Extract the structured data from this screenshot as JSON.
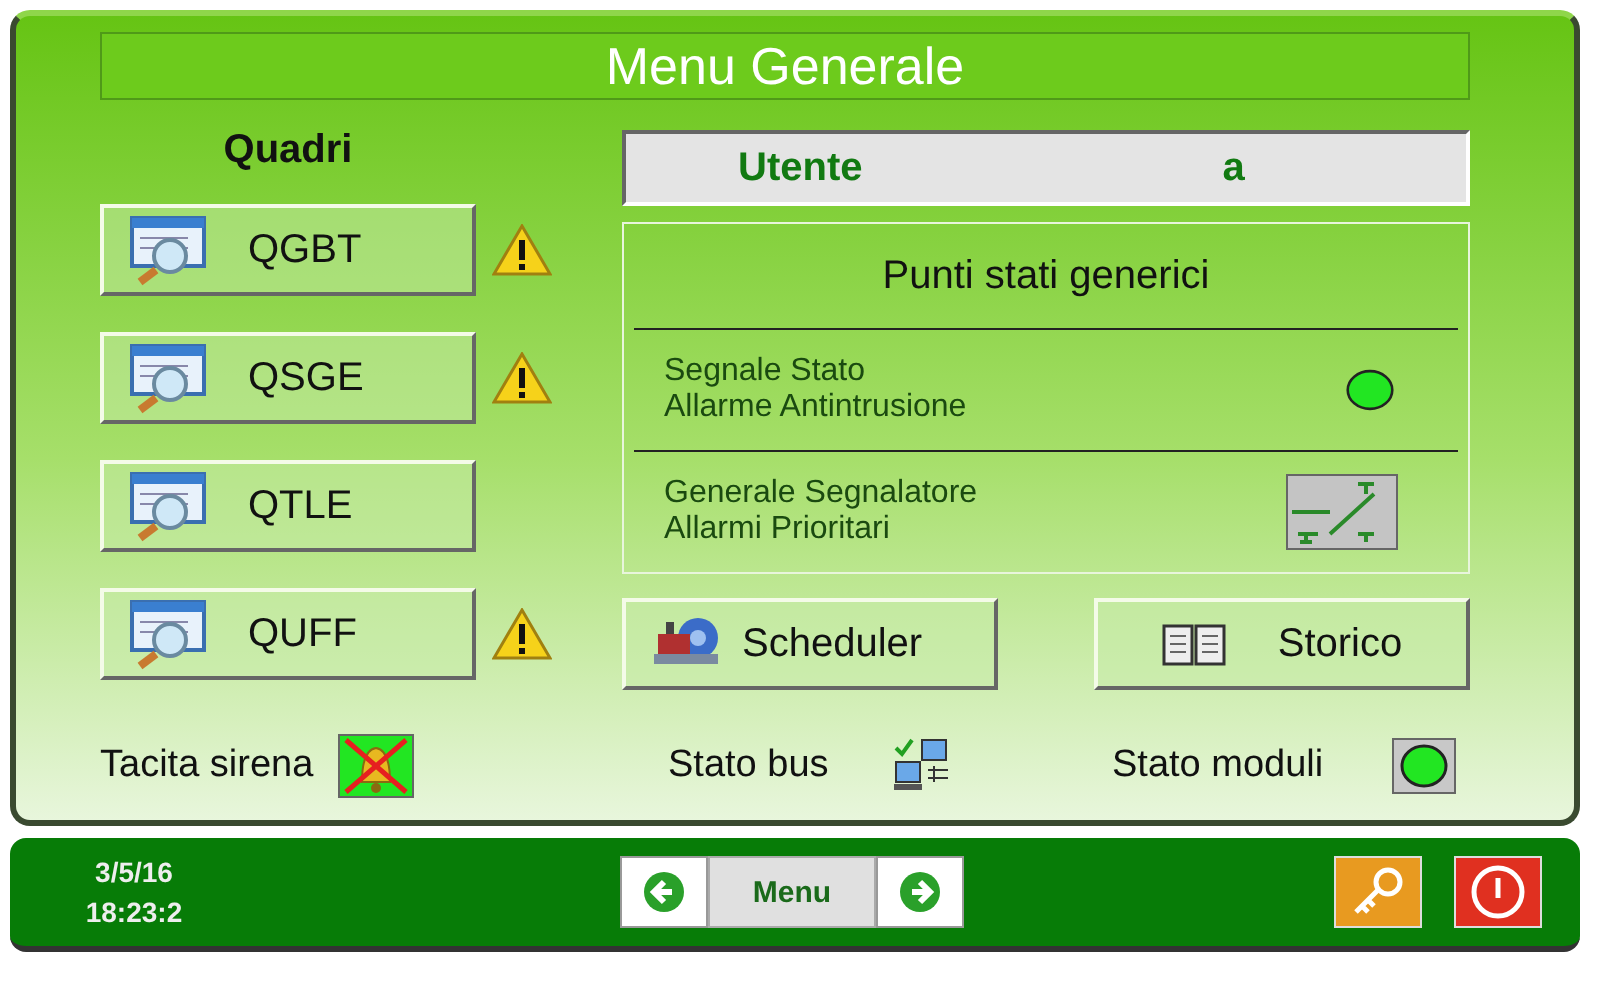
{
  "title": "Menu Generale",
  "quadri": {
    "heading": "Quadri",
    "items": [
      {
        "label": "QGBT",
        "warning": true
      },
      {
        "label": "QSGE",
        "warning": true
      },
      {
        "label": "QTLE",
        "warning": false
      },
      {
        "label": "QUFF",
        "warning": true
      }
    ]
  },
  "user": {
    "label": "Utente",
    "value": "a"
  },
  "status_points": {
    "title": "Punti stati generici",
    "rows": [
      {
        "lines": [
          "Segnale Stato",
          "Allarme Antintrusione"
        ],
        "kind": "led",
        "on": true
      },
      {
        "lines": [
          "Generale Segnalatore",
          "Allarmi Prioritari"
        ],
        "kind": "switch"
      }
    ]
  },
  "actions": [
    {
      "label": "Scheduler",
      "kind": "scheduler"
    },
    {
      "label": "Storico",
      "kind": "book"
    }
  ],
  "status_bar": [
    {
      "label": "Tacita sirena",
      "kind": "siren"
    },
    {
      "label": "Stato bus",
      "kind": "network"
    },
    {
      "label": "Stato moduli",
      "kind": "led",
      "on": true
    }
  ],
  "footer": {
    "date": "3/5/16",
    "time": "18:23:2",
    "nav": {
      "label": "Menu"
    }
  }
}
